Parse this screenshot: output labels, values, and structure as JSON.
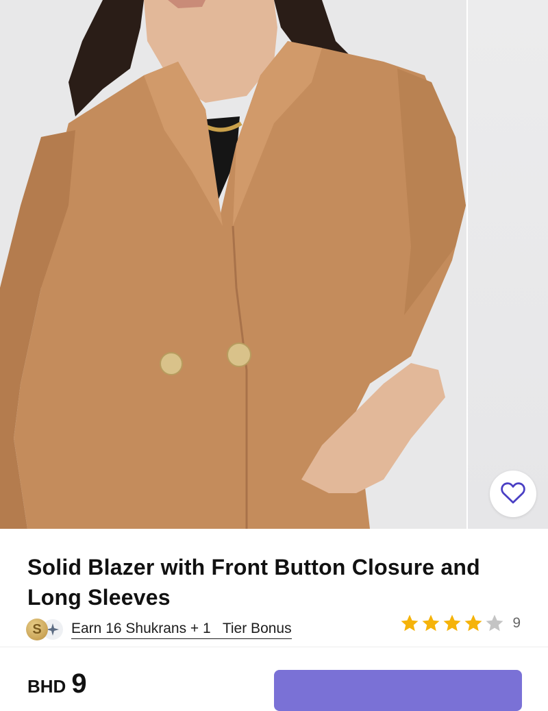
{
  "product": {
    "image_alt": "Woman wearing a tan suede-look double-breasted blazer",
    "title": "Solid Blazer with Front Button Closure and Long Sleeves"
  },
  "rewards": {
    "coin_letter": "S",
    "link_text": "Earn 16 Shukrans + 1   Tier Bonus"
  },
  "rating": {
    "stars_filled": 4,
    "stars_total": 5,
    "count": "9"
  },
  "price": {
    "currency": "BHD",
    "amount": "9"
  },
  "colors": {
    "star_filled": "#f5b30a",
    "star_empty": "#c4c4c4",
    "heart_icon": "#4a3fc4",
    "button": "#7a71d6",
    "blazer": "#c48c5c"
  },
  "icons": {
    "wishlist": "heart-outline-icon",
    "coin": "shukran-coin-icon",
    "tier": "tier-sparkle-icon",
    "star": "star-icon"
  }
}
